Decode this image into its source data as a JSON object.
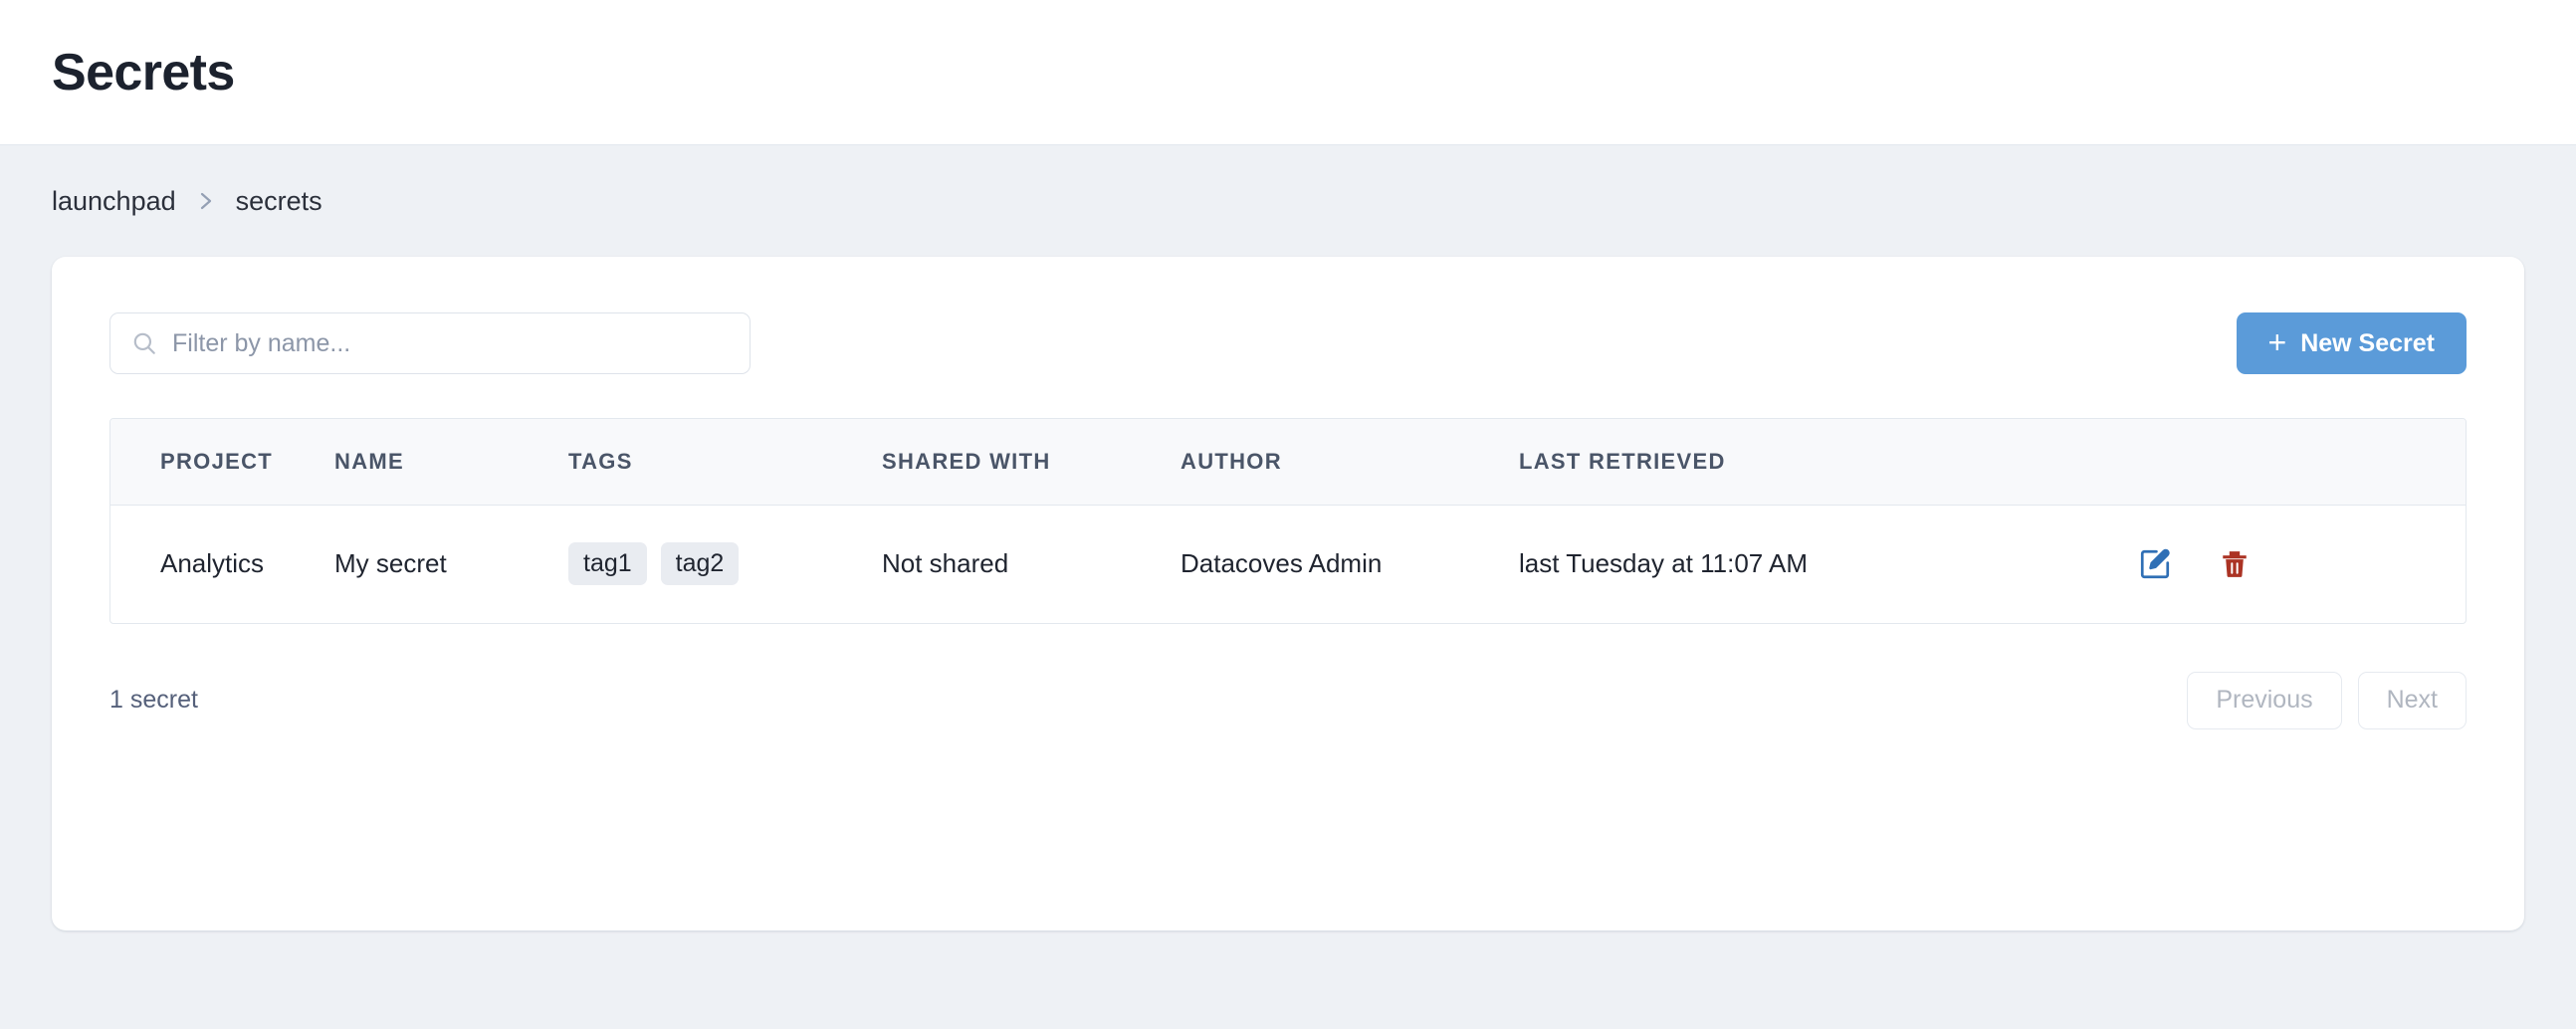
{
  "header": {
    "title": "Secrets"
  },
  "breadcrumb": {
    "items": [
      {
        "label": "launchpad"
      },
      {
        "label": "secrets"
      }
    ],
    "separator_icon": "chevron-right-icon"
  },
  "toolbar": {
    "search": {
      "placeholder": "Filter by name...",
      "value": "",
      "icon": "search-icon"
    },
    "new_secret": {
      "label": "New Secret",
      "plus": "+",
      "color": "#5b9bd9"
    }
  },
  "table": {
    "columns": [
      {
        "key": "project",
        "label": "PROJECT"
      },
      {
        "key": "name",
        "label": "NAME"
      },
      {
        "key": "tags",
        "label": "TAGS"
      },
      {
        "key": "shared_with",
        "label": "SHARED WITH"
      },
      {
        "key": "author",
        "label": "AUTHOR"
      },
      {
        "key": "last_retrieved",
        "label": "LAST RETRIEVED"
      },
      {
        "key": "actions",
        "label": ""
      }
    ],
    "rows": [
      {
        "project": "Analytics",
        "name": "My secret",
        "tags": [
          "tag1",
          "tag2"
        ],
        "shared_with": "Not shared",
        "author": "Datacoves Admin",
        "last_retrieved": "last Tuesday at 11:07 AM",
        "actions": {
          "edit_icon": "edit-pencil-icon",
          "edit_color": "#2f6fb5",
          "delete_icon": "trash-icon",
          "delete_color": "#ab3324"
        }
      }
    ]
  },
  "footer": {
    "count_label": "1 secret",
    "previous_label": "Previous",
    "next_label": "Next"
  }
}
